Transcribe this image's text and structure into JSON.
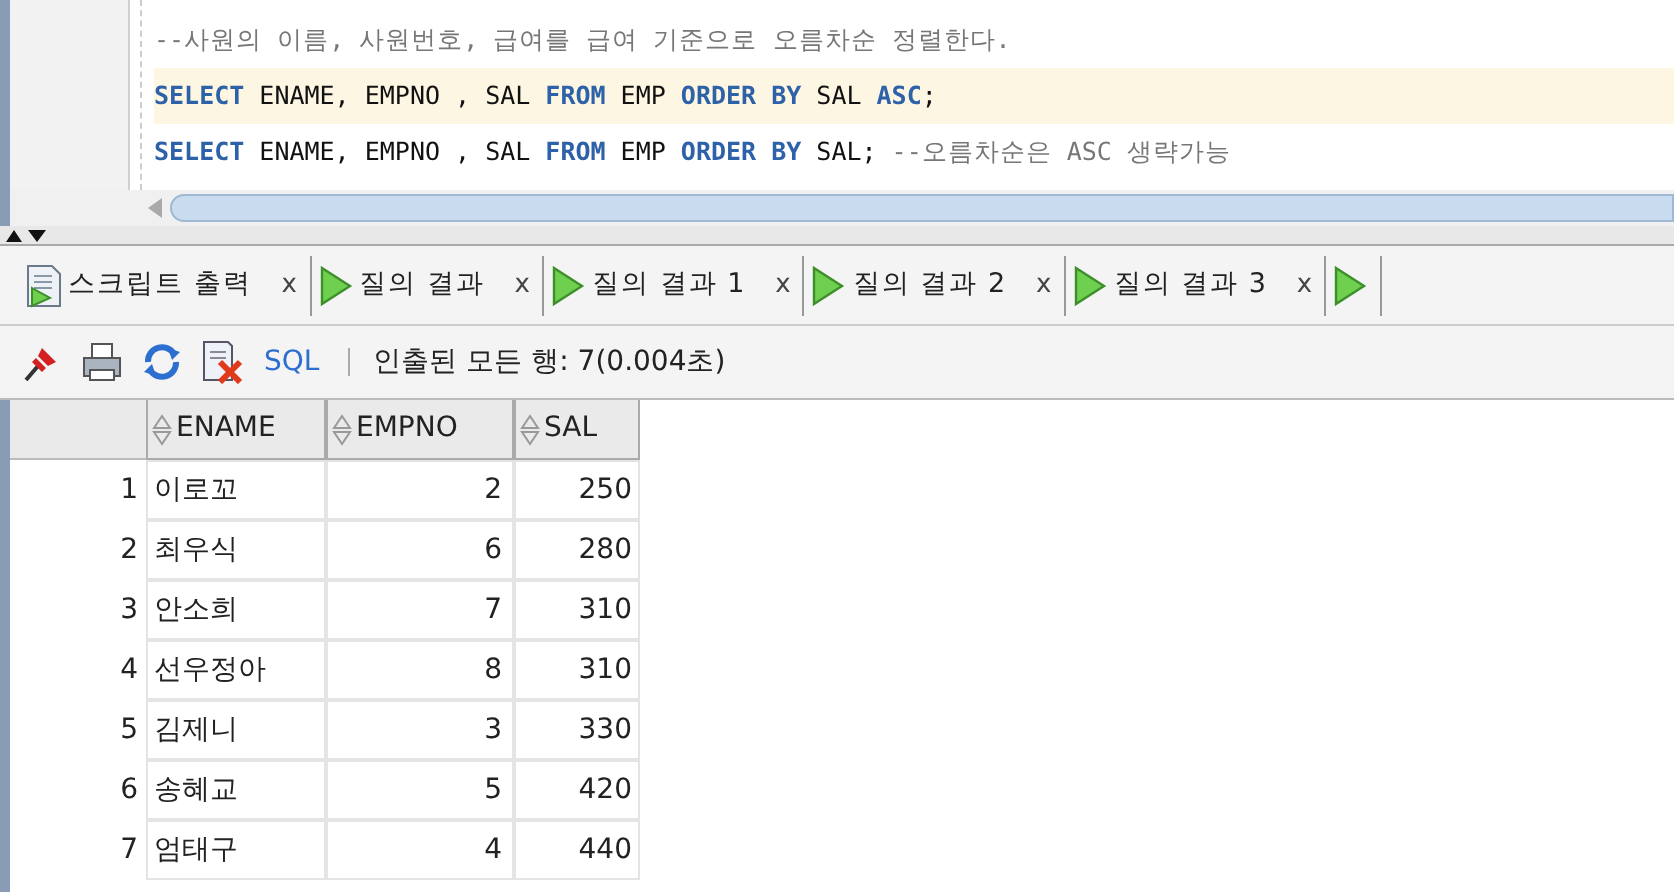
{
  "editor": {
    "lines": [
      {
        "current": false,
        "tokens": [
          {
            "kind": "comment",
            "text": "--사원의 이름, 사원번호, 급여를 급여 기준으로 오름차순 정렬한다."
          }
        ]
      },
      {
        "current": true,
        "tokens": [
          {
            "kind": "keyword",
            "text": "SELECT"
          },
          {
            "kind": "plain",
            "text": " ENAME, EMPNO , SAL "
          },
          {
            "kind": "keyword",
            "text": "FROM"
          },
          {
            "kind": "plain",
            "text": " EMP "
          },
          {
            "kind": "keyword",
            "text": "ORDER BY"
          },
          {
            "kind": "plain",
            "text": " SAL "
          },
          {
            "kind": "keyword",
            "text": "ASC"
          },
          {
            "kind": "plain",
            "text": ";"
          }
        ]
      },
      {
        "current": false,
        "tokens": [
          {
            "kind": "keyword",
            "text": "SELECT"
          },
          {
            "kind": "plain",
            "text": " ENAME, EMPNO , SAL "
          },
          {
            "kind": "keyword",
            "text": "FROM"
          },
          {
            "kind": "plain",
            "text": " EMP "
          },
          {
            "kind": "keyword",
            "text": "ORDER BY"
          },
          {
            "kind": "plain",
            "text": " SAL; "
          },
          {
            "kind": "comment",
            "text": "--오름차순은 ASC 생략가능"
          }
        ]
      }
    ]
  },
  "tabs": [
    {
      "kind": "script",
      "label": "스크립트 출력",
      "close": "x"
    },
    {
      "kind": "query",
      "label": "질의 결과",
      "close": "x"
    },
    {
      "kind": "query",
      "label": "질의 결과 1",
      "close": "x"
    },
    {
      "kind": "query",
      "label": "질의 결과 2",
      "close": "x"
    },
    {
      "kind": "query",
      "label": "질의 결과 3",
      "close": "x"
    },
    {
      "kind": "query"
    }
  ],
  "toolbar": {
    "sql_button": "SQL",
    "status": "인출된 모든 행: 7(0.004초)"
  },
  "table": {
    "columns": [
      "",
      "ENAME",
      "EMPNO",
      "SAL"
    ],
    "rows": [
      [
        "1",
        "이로꼬",
        "2",
        "250"
      ],
      [
        "2",
        "최우식",
        "6",
        "280"
      ],
      [
        "3",
        "안소희",
        "7",
        "310"
      ],
      [
        "4",
        "선우정아",
        "8",
        "310"
      ],
      [
        "5",
        "김제니",
        "3",
        "330"
      ],
      [
        "6",
        "송혜교",
        "5",
        "420"
      ],
      [
        "7",
        "엄태구",
        "4",
        "440"
      ]
    ]
  }
}
